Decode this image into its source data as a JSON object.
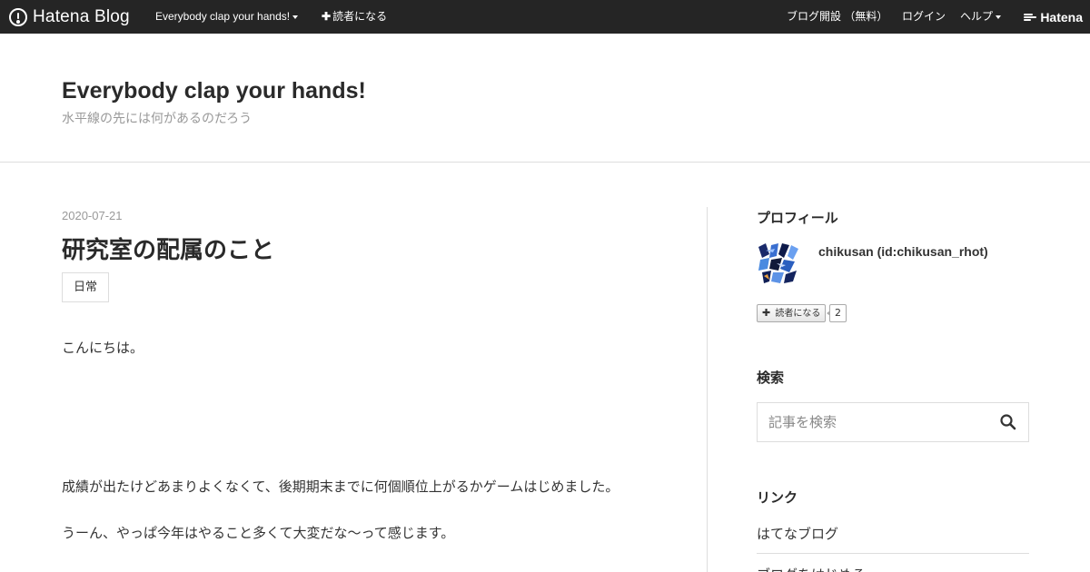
{
  "topbar": {
    "logo_text": "Hatena Blog",
    "blog_menu": "Everybody clap your hands!",
    "subscribe": "読者になる",
    "open_blog": "ブログ開設 （無料）",
    "login": "ログイン",
    "help": "ヘルプ",
    "brand": "Hatena"
  },
  "header": {
    "title": "Everybody clap your hands!",
    "description": "水平線の先には何があるのだろう"
  },
  "entry": {
    "date": "2020-07-21",
    "title": "研究室の配属のこと",
    "category": "日常",
    "paragraphs": [
      "こんにちは。",
      "成績が出たけどあまりよくなくて、後期期末までに何個順位上がるかゲームはじめました。",
      "うーん、やっぱ今年はやること多くて大変だな〜って感じます。"
    ]
  },
  "sidebar": {
    "profile": {
      "heading": "プロフィール",
      "name": "chikusan (id:chikusan_rhot)",
      "subscribe_label": "読者になる",
      "subscriber_count": "2"
    },
    "search": {
      "heading": "検索",
      "placeholder": "記事を検索"
    },
    "links": {
      "heading": "リンク",
      "items": [
        "はてなブログ",
        "ブログをはじめる"
      ]
    }
  },
  "colors": {
    "topbar_bg": "#252525",
    "text": "#333333",
    "muted": "#999999",
    "border": "#dddddd"
  }
}
